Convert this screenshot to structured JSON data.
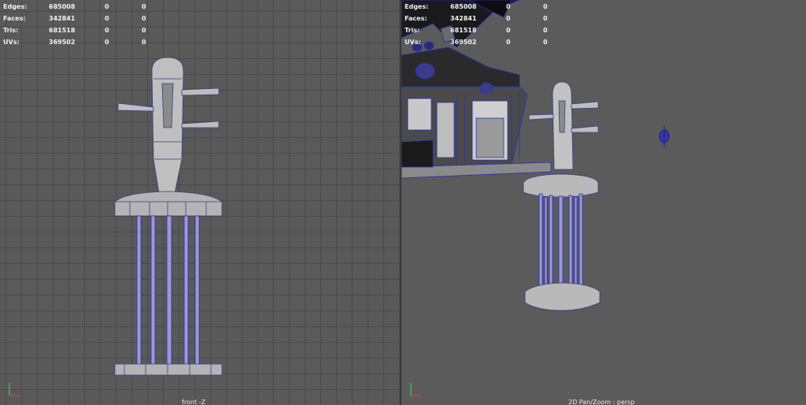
{
  "stats": {
    "rows": [
      {
        "label": "Edges:",
        "total": "685008",
        "selected": "0",
        "object": "0"
      },
      {
        "label": "Faces:",
        "total": "342841",
        "selected": "0",
        "object": "0"
      },
      {
        "label": "Tris:",
        "total": "681518",
        "selected": "0",
        "object": "0"
      },
      {
        "label": "UVs:",
        "total": "369502",
        "selected": "0",
        "object": "0"
      }
    ]
  },
  "viewports": {
    "left": {
      "label": "front -Z"
    },
    "right": {
      "label": "2D Pan/Zoom : persp"
    }
  },
  "axis": {
    "x": "x",
    "y": "y"
  },
  "colors": {
    "grid_bg": "#595959",
    "persp_bg": "#5b5b5b",
    "mesh_fill": "#b9b9b9",
    "wire": "#2b2bb8",
    "hud_text": "#f2f2f2"
  }
}
